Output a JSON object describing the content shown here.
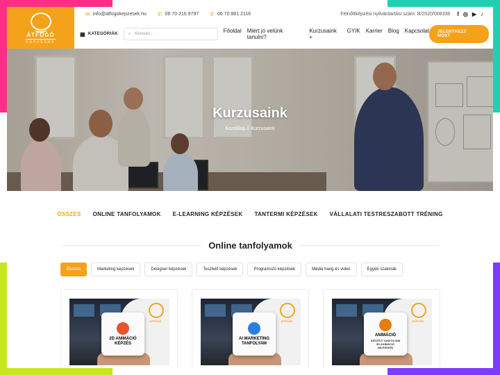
{
  "colors": {
    "accent": "#f4a21a",
    "deco_pink": "#ff2d8a",
    "deco_teal": "#1fd1b2",
    "deco_lime": "#c8e61d",
    "deco_purple": "#7b3cff"
  },
  "logo": {
    "name": "ÁTFOGÓ",
    "sub": "KÉPZÉSEK"
  },
  "topbar": {
    "email": "info@atfogokepzesek.hu",
    "phone1": "06 70 216 9797",
    "phone2": "06 70 881 2116",
    "registration": "Felnőttképzési nyilvántartási szám: B/2020/008338",
    "social_icons": [
      "facebook-icon",
      "instagram-icon",
      "youtube-icon",
      "tiktok-icon"
    ]
  },
  "nav": {
    "categories_label": "KATEGÓRIÁK",
    "search_placeholder": "Keresés...",
    "links": [
      "Főoldal",
      "Miért jó velünk tanulni?",
      "Kurzusaink +",
      "GYIK",
      "Karrier",
      "Blog",
      "Kapcsolat"
    ],
    "cta_label": "JELENTKEZZ MOST"
  },
  "hero": {
    "title": "Kurzusaink",
    "breadcrumb": "Kezdőlap // Kurzusaink"
  },
  "filter_tabs": [
    {
      "label": "ÖSSZES",
      "active": true
    },
    {
      "label": "ONLINE TANFOLYAMOK",
      "active": false
    },
    {
      "label": "E-LEARNING KÉPZÉSEK",
      "active": false
    },
    {
      "label": "TANTERMI KÉPZÉSEK",
      "active": false
    },
    {
      "label": "VÁLLALATI TESTRESZABOTT TRÉNING",
      "active": false
    }
  ],
  "section": {
    "title": "Online tanfolyamok"
  },
  "chips": [
    {
      "label": "Összes",
      "active": true
    },
    {
      "label": "Marketing képzések",
      "active": false
    },
    {
      "label": "Designer képzések",
      "active": false
    },
    {
      "label": "Tesztelő képzések",
      "active": false
    },
    {
      "label": "Programozó képzések",
      "active": false
    },
    {
      "label": "Média hang és videó",
      "active": false
    },
    {
      "label": "Egyéb szakmák",
      "active": false
    }
  ],
  "cards": [
    {
      "box_title": "2D ANIMÁCIÓ\nKÉPZÉS",
      "box_sub": "",
      "icon_color": "#e8532b"
    },
    {
      "box_title": "AI MARKETING\nTANFOLYAM",
      "box_sub": "",
      "icon_color": "#2a7de1"
    },
    {
      "box_title": "ANIMÁCIÓ",
      "box_sub": "KÉSZÍTŐ TANFOLYAM\n3D ANIMÁCIÓ\n(BLENDER)",
      "icon_color": "#e87d0d"
    }
  ]
}
